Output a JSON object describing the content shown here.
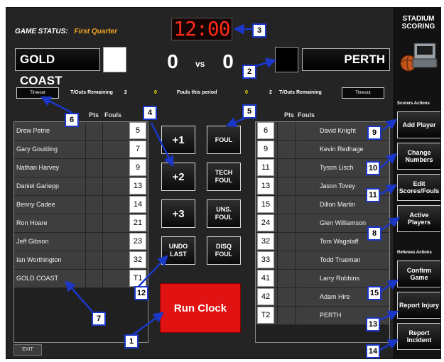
{
  "header": {
    "game_status_label": "GAME STATUS:",
    "game_status_value": "First Quarter",
    "clock": "12:00",
    "vs": "vs"
  },
  "home": {
    "name": "GOLD COAST",
    "score": "0",
    "color": "#ffffff",
    "timeout_label": "Timeout",
    "timeouts_text": "T/Outs Remaining",
    "timeouts_remaining": "2",
    "fouls_this_period": "0",
    "players": [
      {
        "name": "Drew Petrie",
        "number": "5"
      },
      {
        "name": "Gary Goulding",
        "number": "7"
      },
      {
        "name": "Nathan Harvey",
        "number": "9"
      },
      {
        "name": "Daniel Gariepp",
        "number": "13"
      },
      {
        "name": "Benny Cadee",
        "number": "14"
      },
      {
        "name": "Ron Hoare",
        "number": "21"
      },
      {
        "name": "Jeff Gibson",
        "number": "23"
      },
      {
        "name": "Ian Worthington",
        "number": "32"
      },
      {
        "name": "GOLD COAST",
        "number": "T1"
      }
    ]
  },
  "away": {
    "name": "PERTH",
    "score": "0",
    "color": "#000000",
    "timeout_label": "Timeout",
    "timeouts_text": "T/Outs Remaining",
    "timeouts_remaining": "2",
    "fouls_this_period": "0",
    "players": [
      {
        "name": "David Knight",
        "number": "6"
      },
      {
        "name": "Kevin Redhage",
        "number": "9"
      },
      {
        "name": "Tyson Lisch",
        "number": "11"
      },
      {
        "name": "Jason Tovey",
        "number": "13"
      },
      {
        "name": "Dillon Martin",
        "number": "15"
      },
      {
        "name": "Glen Williamson",
        "number": "24"
      },
      {
        "name": "Tom Wagstaff",
        "number": "32"
      },
      {
        "name": "Todd Trueman",
        "number": "33"
      },
      {
        "name": "Larry Robbins",
        "number": "41"
      },
      {
        "name": "Adam Hire",
        "number": "42"
      },
      {
        "name": "PERTH",
        "number": "T2"
      }
    ]
  },
  "fouls_period_label": "Fouls this period",
  "columns": {
    "pts": "Pts",
    "fouls": "Fouls"
  },
  "controls": {
    "plus1": "+1",
    "plus2": "+2",
    "plus3": "+3",
    "undo": "UNDO\nLAST",
    "foul": "FOUL",
    "tech": "TECH\nFOUL",
    "uns": "UNS.\nFOUL",
    "disq": "DISQ\nFOUL",
    "run_clock": "Run Clock"
  },
  "sidebar": {
    "brand_line1": "STADIUM",
    "brand_line2": "SCORING",
    "scorers_label": "Scorers Actions",
    "add_player": "Add Player",
    "change_numbers": "Change\nNumbers",
    "edit_scores": "Edit\nScores/Fouls",
    "active_players": "Active\nPlayers",
    "referees_label": "Referees Actions",
    "confirm_game": "Confirm\nGame",
    "report_injury": "Report Injury",
    "report_incident": "Report\nIncident"
  },
  "exit_label": "EXIT",
  "callouts": [
    "1",
    "2",
    "3",
    "4",
    "5",
    "6",
    "7",
    "8",
    "9",
    "10",
    "11",
    "12",
    "13",
    "14",
    "15"
  ],
  "colors": {
    "clock": "#ff2b1a",
    "status": "#f5a623",
    "run_clock": "#e01212",
    "callout_border": "#1b37c8"
  }
}
